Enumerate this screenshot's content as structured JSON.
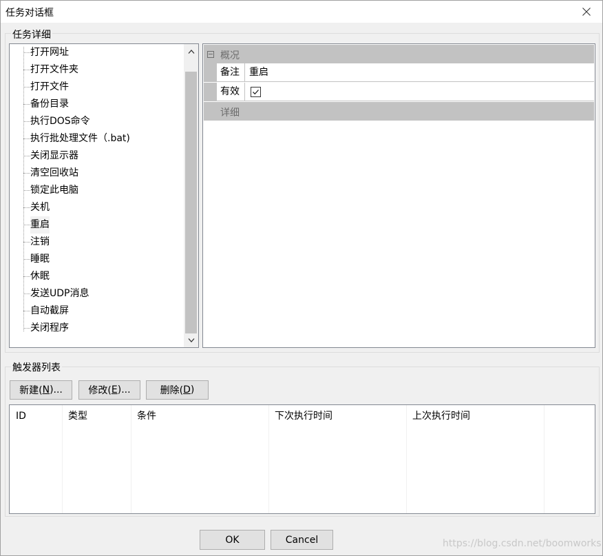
{
  "window": {
    "title": "任务对话框"
  },
  "task_details": {
    "group_label": "任务详细",
    "tree_items": [
      "打开网址",
      "打开文件夹",
      "打开文件",
      "备份目录",
      "执行DOS命令",
      "执行批处理文件（.bat)",
      "关闭显示器",
      "清空回收站",
      "锁定此电脑",
      "关机",
      "重启",
      "注销",
      "睡眠",
      "休眠",
      "发送UDP消息",
      "自动截屏",
      "关闭程序"
    ],
    "selected_item": "重启",
    "properties": {
      "category_overview": "概况",
      "note_label": "备注",
      "note_value": "重启",
      "enabled_label": "有效",
      "enabled_checked": true,
      "category_detail": "详细"
    }
  },
  "triggers": {
    "group_label": "触发器列表",
    "buttons": {
      "new": {
        "text": "新建(",
        "key": "N",
        "suffix": ")..."
      },
      "edit": {
        "text": "修改(",
        "key": "E",
        "suffix": ")..."
      },
      "delete": {
        "text": "删除(",
        "key": "D",
        "suffix": ")"
      }
    },
    "columns": [
      "ID",
      "类型",
      "条件",
      "下次执行时间",
      "上次执行时间"
    ],
    "rows": []
  },
  "footer": {
    "ok_label": "OK",
    "cancel_label": "Cancel"
  },
  "watermark": "https://blog.csdn.net/boomworks",
  "colors": {
    "category_bg": "#c2c2c2",
    "dialog_bg": "#f0f0f0",
    "scroll_thumb": "#c2c2c2"
  }
}
